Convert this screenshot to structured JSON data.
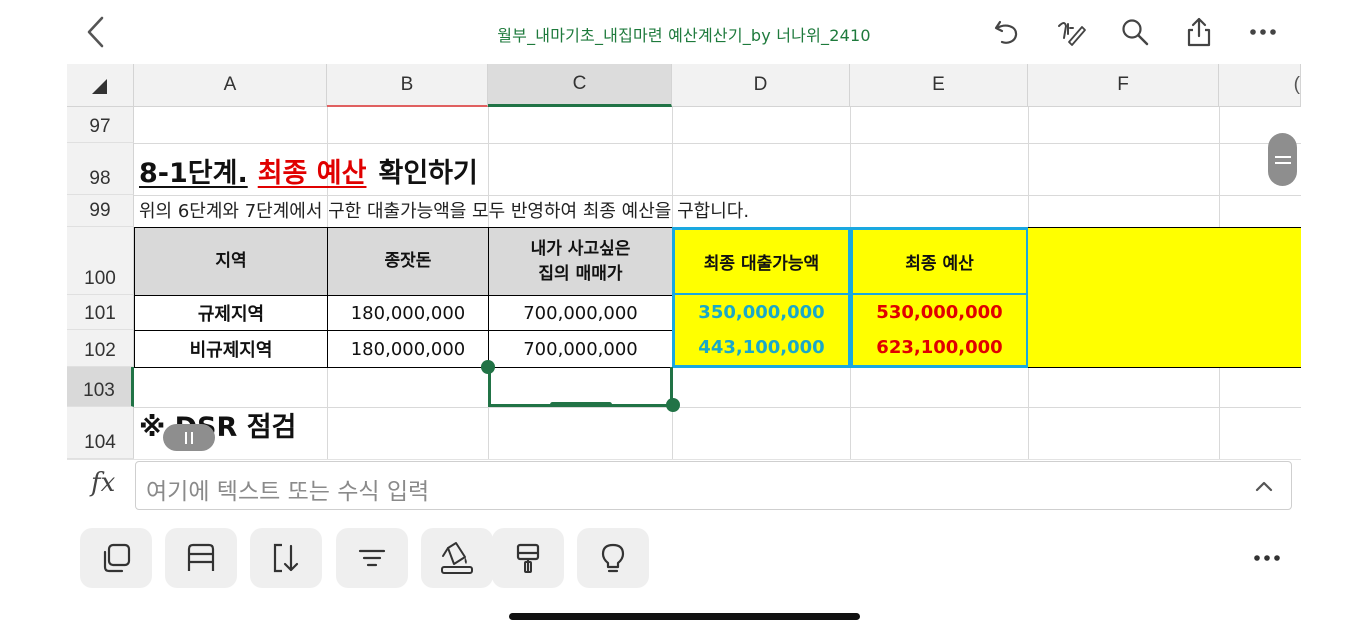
{
  "topbar": {
    "title": "월부_내마기초_내집마련 예산계산기_by 너나위_2410",
    "icons": [
      "back-icon",
      "undo-icon",
      "draw-icon",
      "search-icon",
      "share-icon",
      "more-icon"
    ]
  },
  "sheet": {
    "columns": [
      "A",
      "B",
      "C",
      "D",
      "E",
      "F"
    ],
    "rows": [
      "97",
      "98",
      "99",
      "100",
      "101",
      "102",
      "103",
      "104"
    ],
    "heading_prefix": "8-1단계.",
    "heading_highlight": "최종 예산",
    "heading_suffix": "확인하기",
    "description": "위의 6단계와 7단계에서 구한 대출가능액을 모두 반영하여 최종 예산을 구합니다.",
    "table": {
      "headers": [
        "지역",
        "종잣돈",
        "내가 사고싶은\n집의 매매가",
        "최종 대출가능액",
        "최종 예산"
      ],
      "rows": [
        [
          "규제지역",
          "180,000,000",
          "700,000,000",
          "350,000,000",
          "530,000,000"
        ],
        [
          "비규제지역",
          "180,000,000",
          "700,000,000",
          "443,100,000",
          "623,100,000"
        ]
      ]
    },
    "next_heading": "※ DSR 점검"
  },
  "formula_bar": {
    "fx_label": "fx",
    "placeholder": "여기에 텍스트 또는 수식 입력"
  },
  "toolbar": {
    "icons": [
      "copy-icon",
      "table-format-icon",
      "sort-icon",
      "filter-icon",
      "fill-color-icon",
      "format-painter-icon",
      "ideas-icon",
      "more-icon"
    ]
  },
  "colors": {
    "title_green": "#1e7a3c",
    "highlight_red": "#e00000",
    "loan_teal": "#1aa8c8",
    "budget_red": "#e00000",
    "yellow": "#ffff00",
    "selection_green": "#217346",
    "table_header_gray": "#d9d9d9"
  }
}
